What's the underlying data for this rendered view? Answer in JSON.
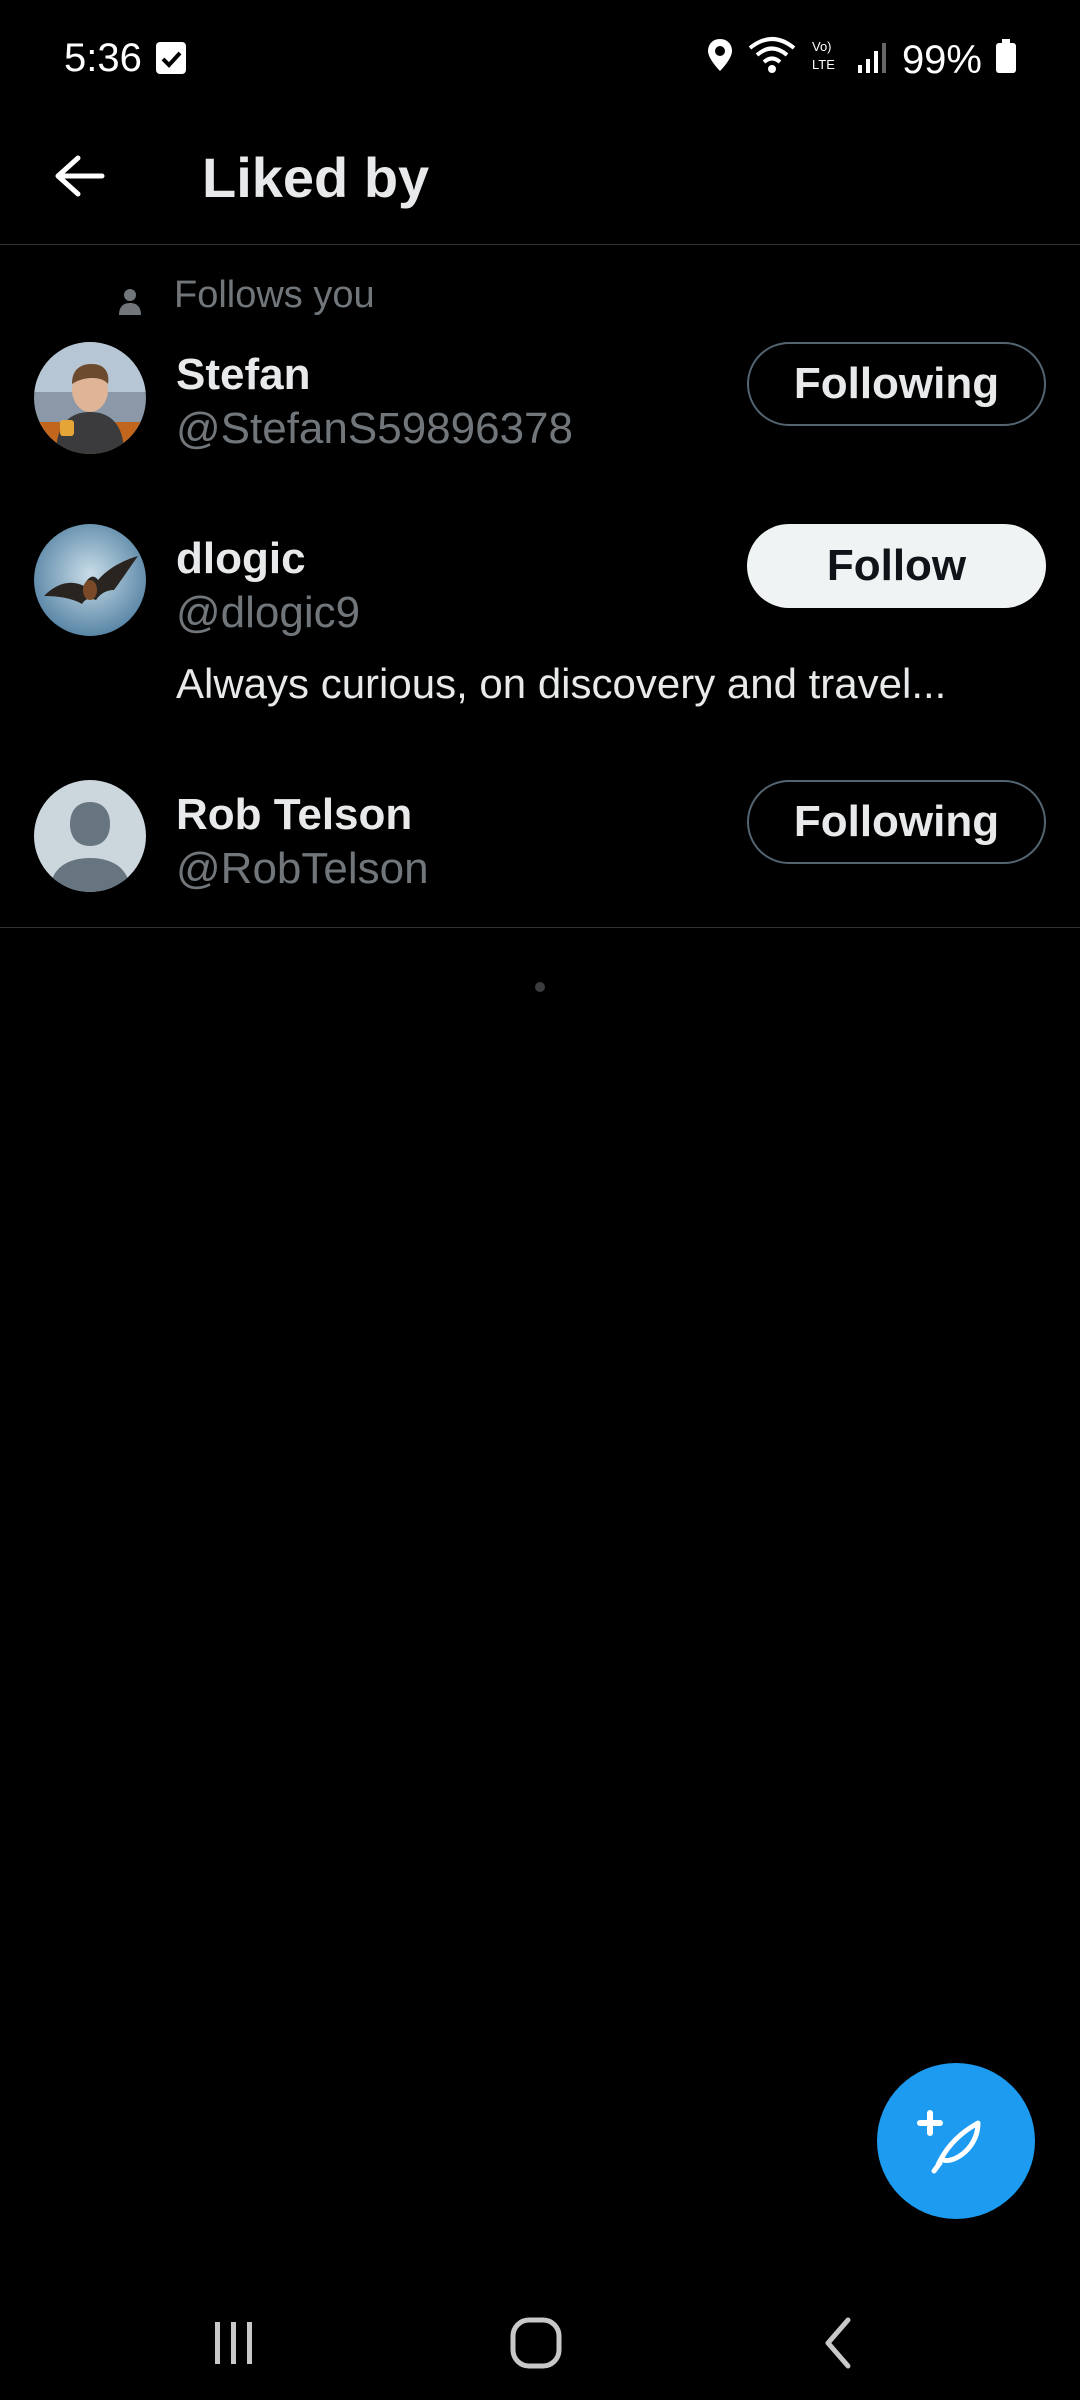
{
  "status_bar": {
    "time": "5:36",
    "battery": "99%",
    "icons": [
      "notification-check-icon",
      "location-icon",
      "wifi-icon",
      "volte-icon",
      "signal-icon",
      "battery-icon"
    ]
  },
  "header": {
    "title": "Liked by",
    "back_icon": "arrow-left-icon"
  },
  "users": [
    {
      "social_context": "Follows you",
      "name": "Stefan",
      "handle": "@StefanS59896378",
      "bio": "",
      "button_label": "Following",
      "button_state": "following"
    },
    {
      "social_context": "",
      "name": "dlogic",
      "handle": "@dlogic9",
      "bio": "Always curious, on discovery and travel...",
      "button_label": "Follow",
      "button_state": "not-following"
    },
    {
      "social_context": "",
      "name": "Rob Telson",
      "handle": "@RobTelson",
      "bio": "",
      "button_label": "Following",
      "button_state": "following"
    }
  ],
  "fab": {
    "icon": "compose-post-icon"
  },
  "nav": {
    "icons": [
      "recents-icon",
      "home-icon",
      "back-icon"
    ]
  },
  "colors": {
    "background": "#000000",
    "accent": "#1d9bf0",
    "text_primary": "#e7e9ea",
    "text_secondary": "#71767b",
    "divider": "#2f3336"
  }
}
